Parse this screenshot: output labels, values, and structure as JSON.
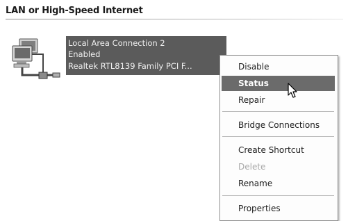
{
  "group": {
    "title": "LAN or High-Speed Internet"
  },
  "connection": {
    "name": "Local Area Connection 2",
    "status": "Enabled",
    "device": "Realtek RTL8139 Family PCI F...",
    "icon": "network-connection-icon"
  },
  "context_menu": {
    "items": [
      {
        "label": "Disable",
        "state": "normal"
      },
      {
        "label": "Status",
        "state": "selected"
      },
      {
        "label": "Repair",
        "state": "normal"
      },
      {
        "label": "Bridge Connections",
        "state": "normal"
      },
      {
        "label": "Create Shortcut",
        "state": "normal"
      },
      {
        "label": "Delete",
        "state": "disabled"
      },
      {
        "label": "Rename",
        "state": "normal"
      },
      {
        "label": "Properties",
        "state": "normal"
      }
    ]
  },
  "cursor": {
    "icon": "mouse-pointer-icon"
  }
}
